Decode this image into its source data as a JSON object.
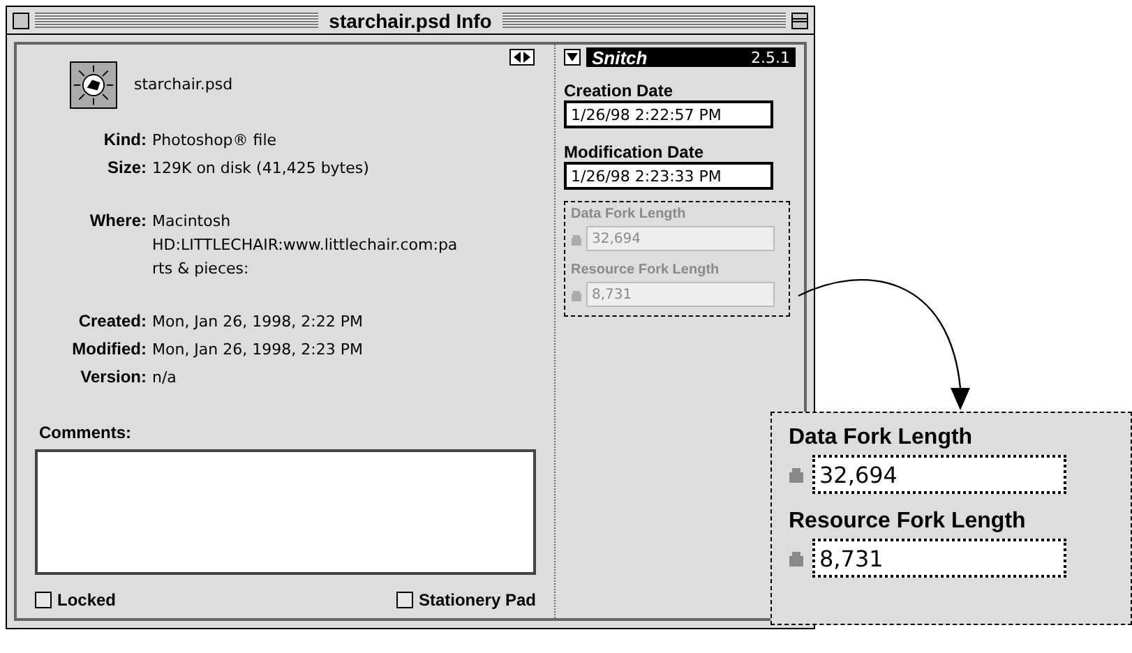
{
  "window": {
    "title": "starchair.psd Info"
  },
  "file": {
    "name": "starchair.psd"
  },
  "info_groups": [
    [
      {
        "label": "Kind:",
        "value": "Photoshop® file"
      },
      {
        "label": "Size:",
        "value": "129K on disk (41,425 bytes)"
      }
    ],
    [
      {
        "label": "Where:",
        "value": "Macintosh\nHD:LITTLECHAIR:www.littlechair.com:pa\nrts & pieces:"
      }
    ],
    [
      {
        "label": "Created:",
        "value": "Mon, Jan 26, 1998, 2:22 PM"
      },
      {
        "label": "Modified:",
        "value": "Mon, Jan 26, 1998, 2:23 PM"
      },
      {
        "label": "Version:",
        "value": "n/a"
      }
    ]
  ],
  "comments": {
    "label": "Comments:"
  },
  "checkboxes": [
    {
      "label": "Locked",
      "checked": false
    },
    {
      "label": "Stationery Pad",
      "checked": false
    }
  ],
  "snitch": {
    "title": "Snitch",
    "version": "2.5.1",
    "expanded": true,
    "dates": [
      {
        "label": "Creation Date",
        "value": "1/26/98 2:22:57 PM"
      },
      {
        "label": "Modification Date",
        "value": "1/26/98 2:23:33 PM"
      }
    ],
    "forks": [
      {
        "label": "Data Fork Length",
        "value": "32,694",
        "disabled": true
      },
      {
        "label": "Resource Fork Length",
        "value": "8,731",
        "disabled": true
      }
    ]
  },
  "magnified": {
    "forks": [
      {
        "label": "Data Fork Length",
        "value": "32,694"
      },
      {
        "label": "Resource Fork Length",
        "value": "8,731"
      }
    ]
  }
}
